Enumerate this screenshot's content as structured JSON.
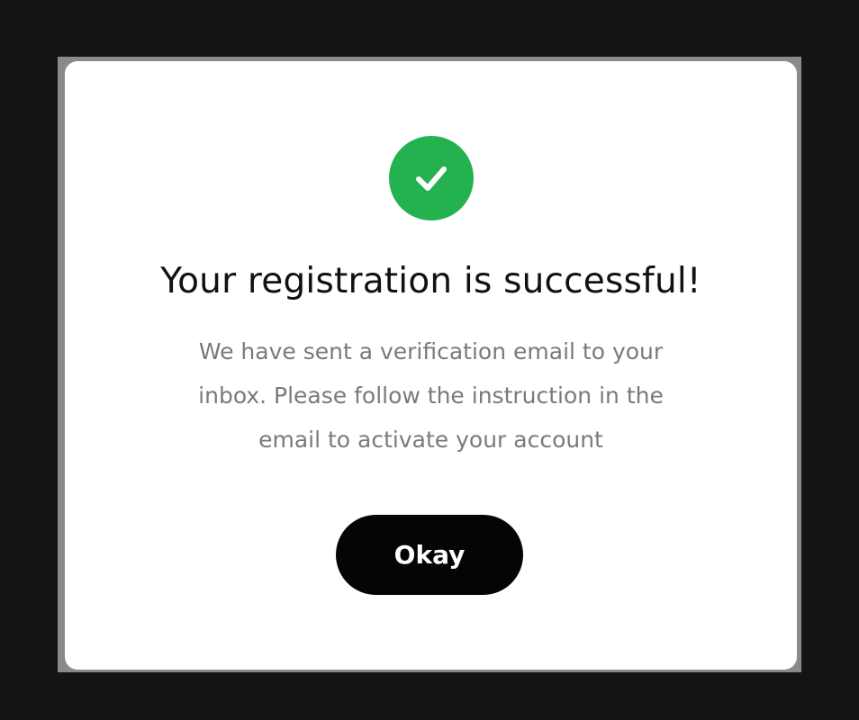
{
  "dialog": {
    "icon": "check-circle-icon",
    "title": "Your registration is successful!",
    "message": "We have sent a verification email to your inbox. Please follow the instruction in the email to activate your account",
    "button_label": "Okay"
  },
  "colors": {
    "success": "#24b14f",
    "button_background": "#050505",
    "button_text": "#ffffff",
    "message_text": "#7a7a7a",
    "overlay": "#141414"
  }
}
